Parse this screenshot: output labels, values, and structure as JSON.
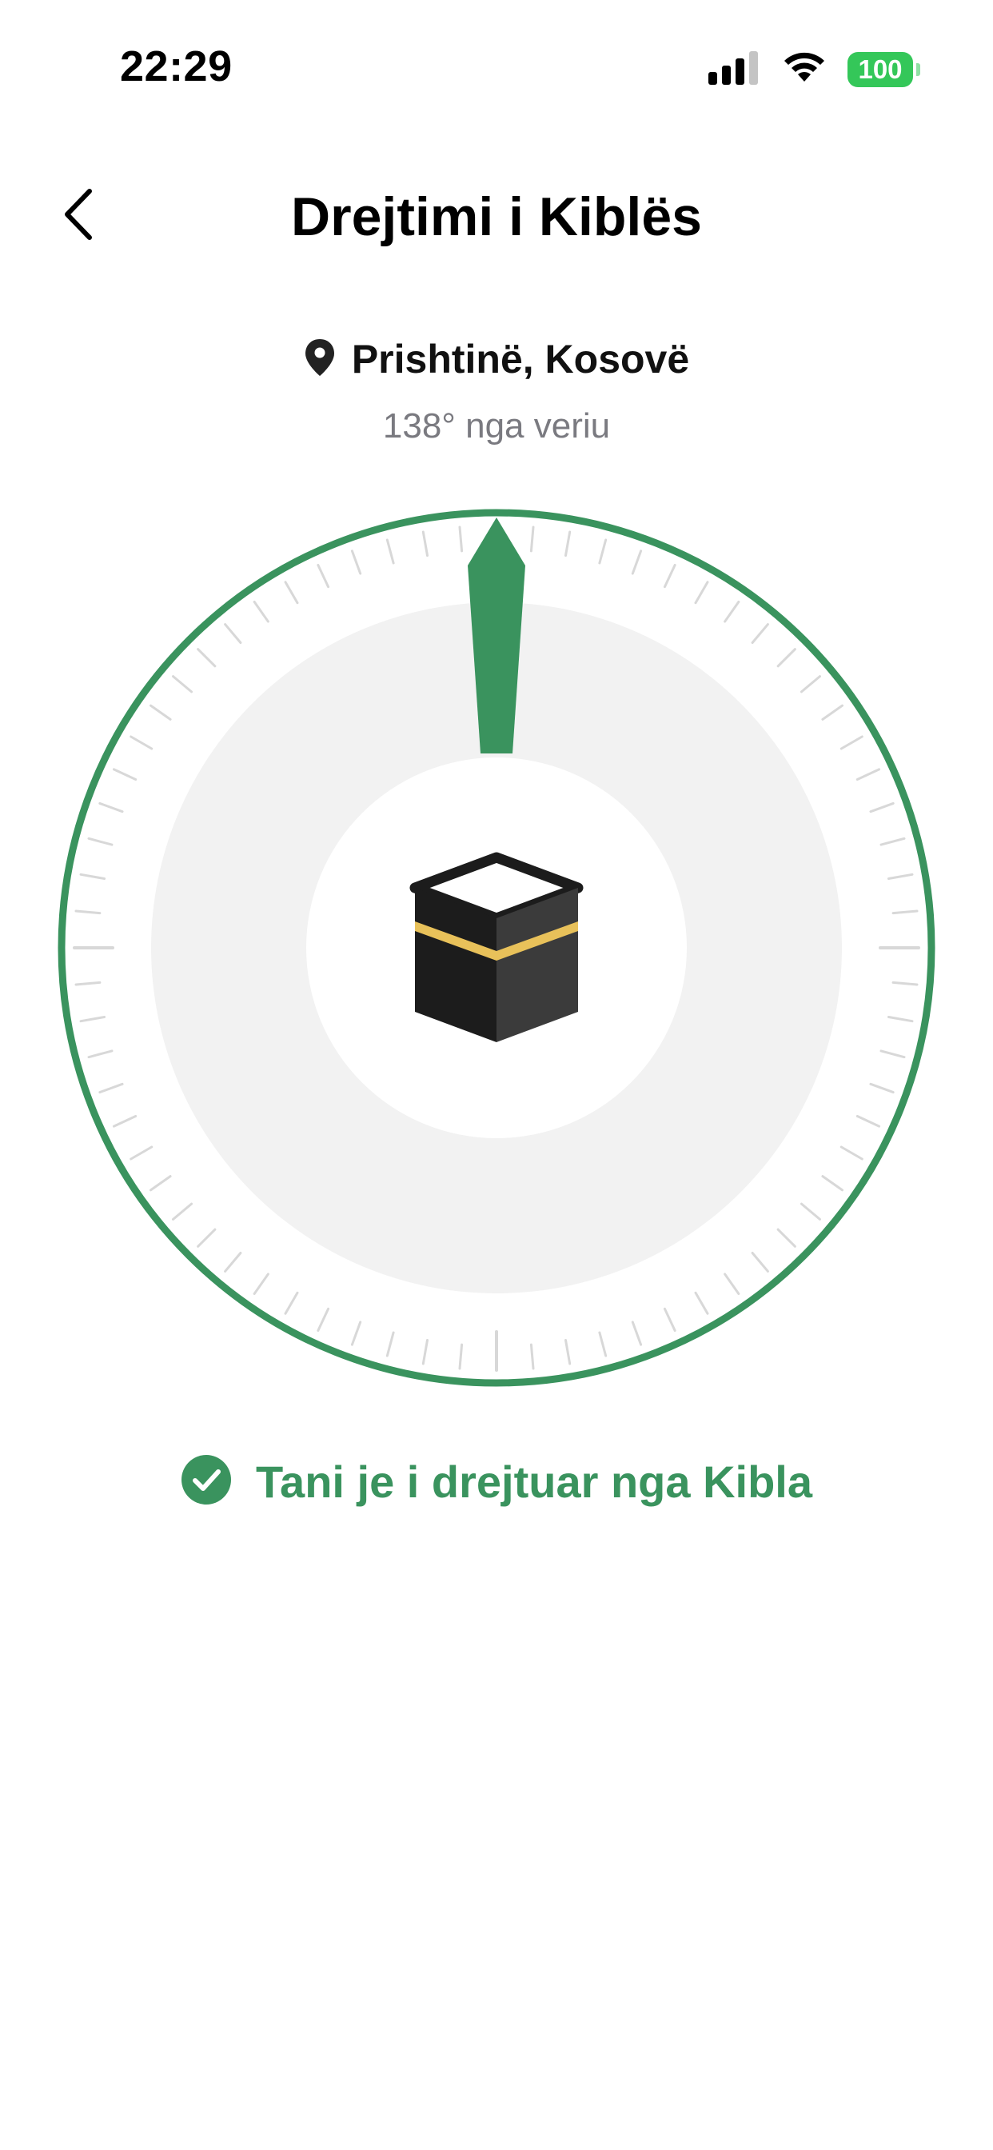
{
  "status_bar": {
    "time": "22:29",
    "battery": "100"
  },
  "header": {
    "title": "Drejtimi i Kiblës",
    "back_icon": "chevron-left-icon"
  },
  "location": {
    "icon": "location-pin-icon",
    "name": "Prishtinë, Kosovë",
    "bearing": "138° nga veriu",
    "bearing_degrees": 138
  },
  "compass": {
    "center_icon": "kaaba-icon",
    "needle_direction": "up",
    "tick_count": 72
  },
  "status": {
    "icon": "checkmark-circle-icon",
    "message": "Tani je i drejtuar nga Kibla"
  },
  "colors": {
    "accent": "#3a935e",
    "ring_fill": "#f2f2f2",
    "tick": "#d8d8d8",
    "battery": "#34c759",
    "kaaba_gold": "#e8c15a"
  }
}
